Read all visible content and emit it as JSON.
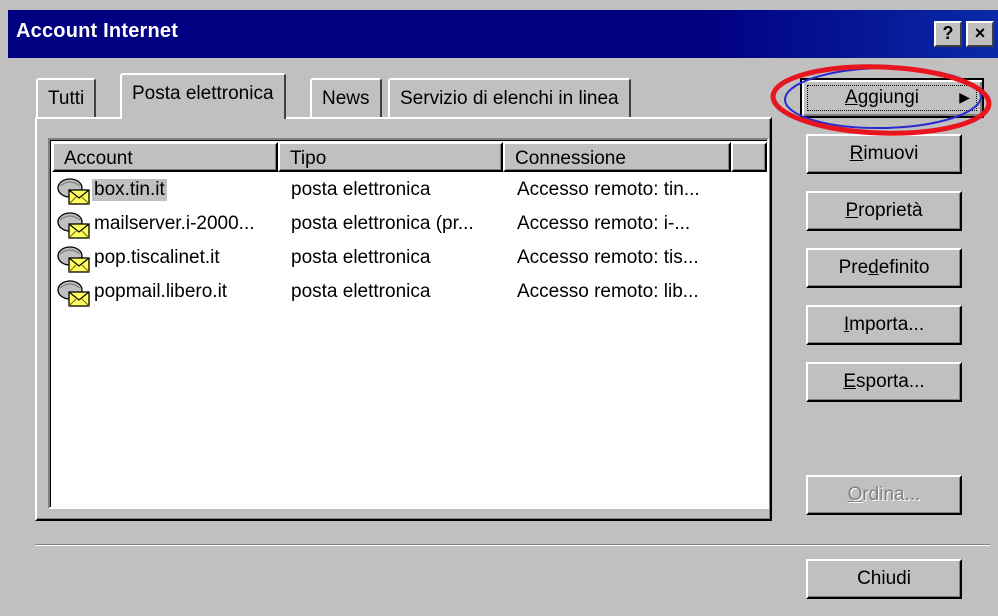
{
  "window": {
    "title": "Account Internet",
    "help_button": "?",
    "close_button": "×"
  },
  "tabs": [
    {
      "label": "Tutti",
      "active": false
    },
    {
      "label": "Posta elettronica",
      "active": true
    },
    {
      "label": "News",
      "active": false
    },
    {
      "label": "Servizio di elenchi in linea",
      "active": false
    }
  ],
  "list": {
    "columns": [
      "Account",
      "Tipo",
      "Connessione"
    ],
    "rows": [
      {
        "account": "box.tin.it",
        "tipo": "posta elettronica",
        "connessione": "Accesso remoto: tin...",
        "selected": true,
        "icon": "mail-account-icon"
      },
      {
        "account": "mailserver.i-2000...",
        "tipo": "posta elettronica (pr...",
        "connessione": "Accesso remoto:  i-...",
        "selected": false,
        "icon": "mail-account-icon"
      },
      {
        "account": "pop.tiscalinet.it",
        "tipo": "posta elettronica",
        "connessione": "Accesso remoto: tis...",
        "selected": false,
        "icon": "mail-account-icon"
      },
      {
        "account": "popmail.libero.it",
        "tipo": "posta elettronica",
        "connessione": "Accesso remoto: lib...",
        "selected": false,
        "icon": "mail-account-icon"
      }
    ]
  },
  "buttons": {
    "aggiungi": {
      "pre": "",
      "key": "A",
      "post": "ggiungi",
      "arrow": "▶"
    },
    "rimuovi": {
      "pre": "",
      "key": "R",
      "post": "imuovi"
    },
    "proprieta": {
      "pre": "",
      "key": "P",
      "post": "roprietà"
    },
    "predefinito": {
      "pre": "Pre",
      "key": "d",
      "post": "efinito"
    },
    "importa": {
      "pre": "",
      "key": "I",
      "post": "mporta..."
    },
    "esporta": {
      "pre": "",
      "key": "E",
      "post": "sporta..."
    },
    "ordina": {
      "pre": "",
      "key": "O",
      "post": "rdina...",
      "disabled": true
    },
    "chiudi": {
      "label": "Chiudi"
    }
  },
  "colors": {
    "title_bar": "#000080",
    "face": "#c0c0c0",
    "annotation_red": "#e8141e",
    "annotation_blue": "#2a2ad0"
  }
}
